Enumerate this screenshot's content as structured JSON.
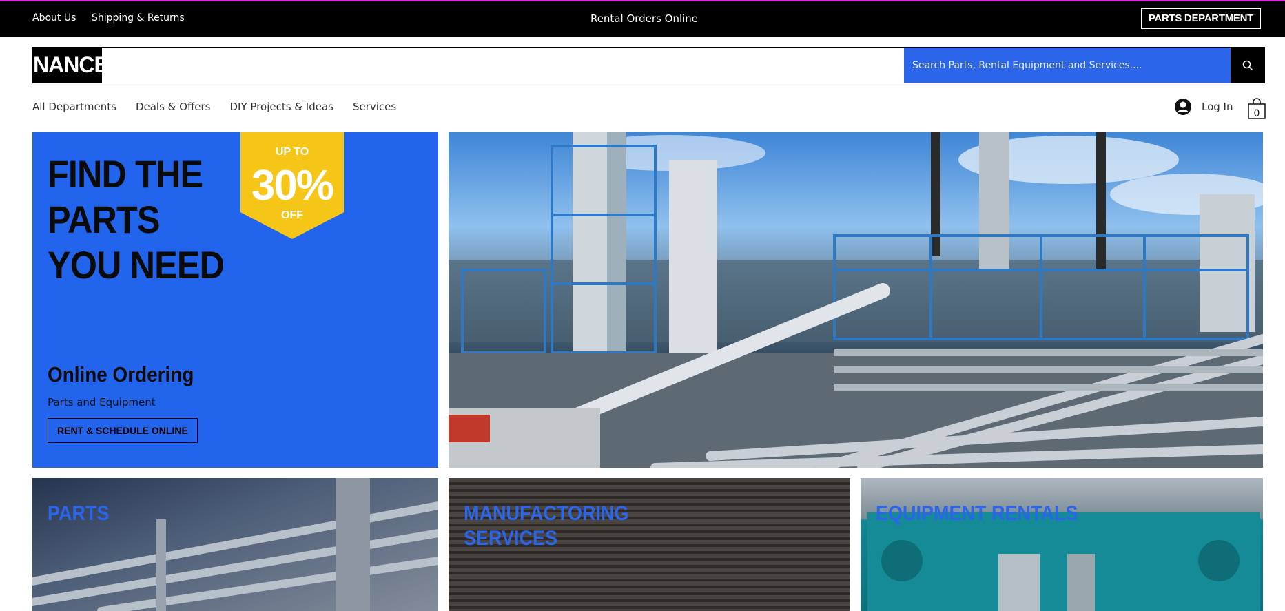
{
  "topbar": {
    "about": "About Us",
    "shipping": "Shipping & Returns",
    "center_text": "Rental Orders Online",
    "parts_department": "PARTS DEPARTMENT"
  },
  "header": {
    "logo": "NANCE",
    "search_placeholder": "Search Parts, Rental Equipment and Services...."
  },
  "nav": {
    "items": [
      "All Departments",
      "Deals & Offers",
      "DIY Projects & Ideas",
      "Services"
    ],
    "login": "Log In",
    "cart_count": "0"
  },
  "hero": {
    "title": "FIND THE PARTS YOU NEED",
    "badge": {
      "line1": "UP TO",
      "line2": "30%",
      "line3": "OFF"
    },
    "ordering_title": "Online Ordering",
    "ordering_sub": "Parts and Equipment",
    "cta": "RENT & SCHEDULE ONLINE"
  },
  "cards": [
    {
      "label": "PARTS"
    },
    {
      "label": "MANUFACTORING SERVICES"
    },
    {
      "label": "EQUIPMENT RENTALS"
    }
  ],
  "colors": {
    "brand_blue": "#2264ec",
    "badge_yellow": "#f5c518",
    "topbar_accent": "#d42fd4"
  }
}
